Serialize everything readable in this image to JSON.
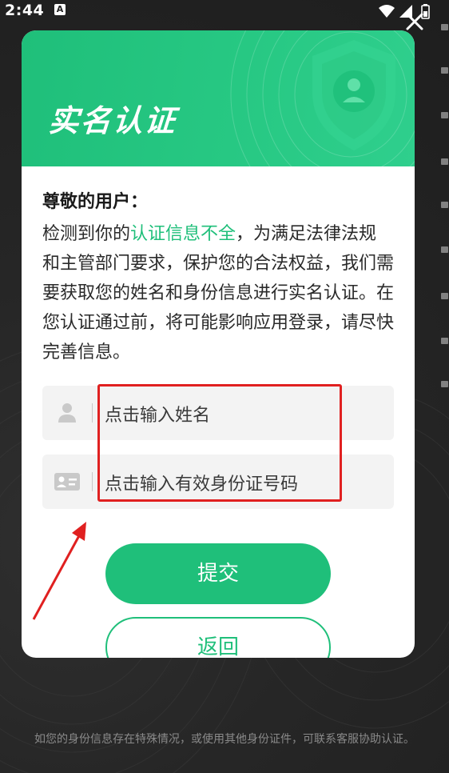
{
  "status_bar": {
    "time": "2:44",
    "notification_badge": "A",
    "icons": [
      "wifi-icon",
      "signal-icon",
      "battery-icon"
    ]
  },
  "dialog": {
    "title": "实名认证",
    "greeting": "尊敬的用户：",
    "notice": {
      "prefix": "检测到你的",
      "highlight": "认证信息不全",
      "suffix": "，为满足法律法规和主管部门要求，保护您的合法权益，我们需要获取您的姓名和身份信息进行实名认证。在您认证通过前，将可能影响应用登录，请尽快完善信息。"
    },
    "name_field": {
      "placeholder": "点击输入姓名",
      "value": ""
    },
    "id_field": {
      "placeholder": "点击输入有效身份证号码",
      "value": ""
    },
    "submit_label": "提交",
    "back_label": "返回"
  },
  "footer_note": "如您的身份信息存在特殊情况，或使用其他身份证件，可联系客服协助认证。",
  "colors": {
    "accent": "#1fbf7a",
    "annotation": "#e02020",
    "background": "#262626"
  }
}
